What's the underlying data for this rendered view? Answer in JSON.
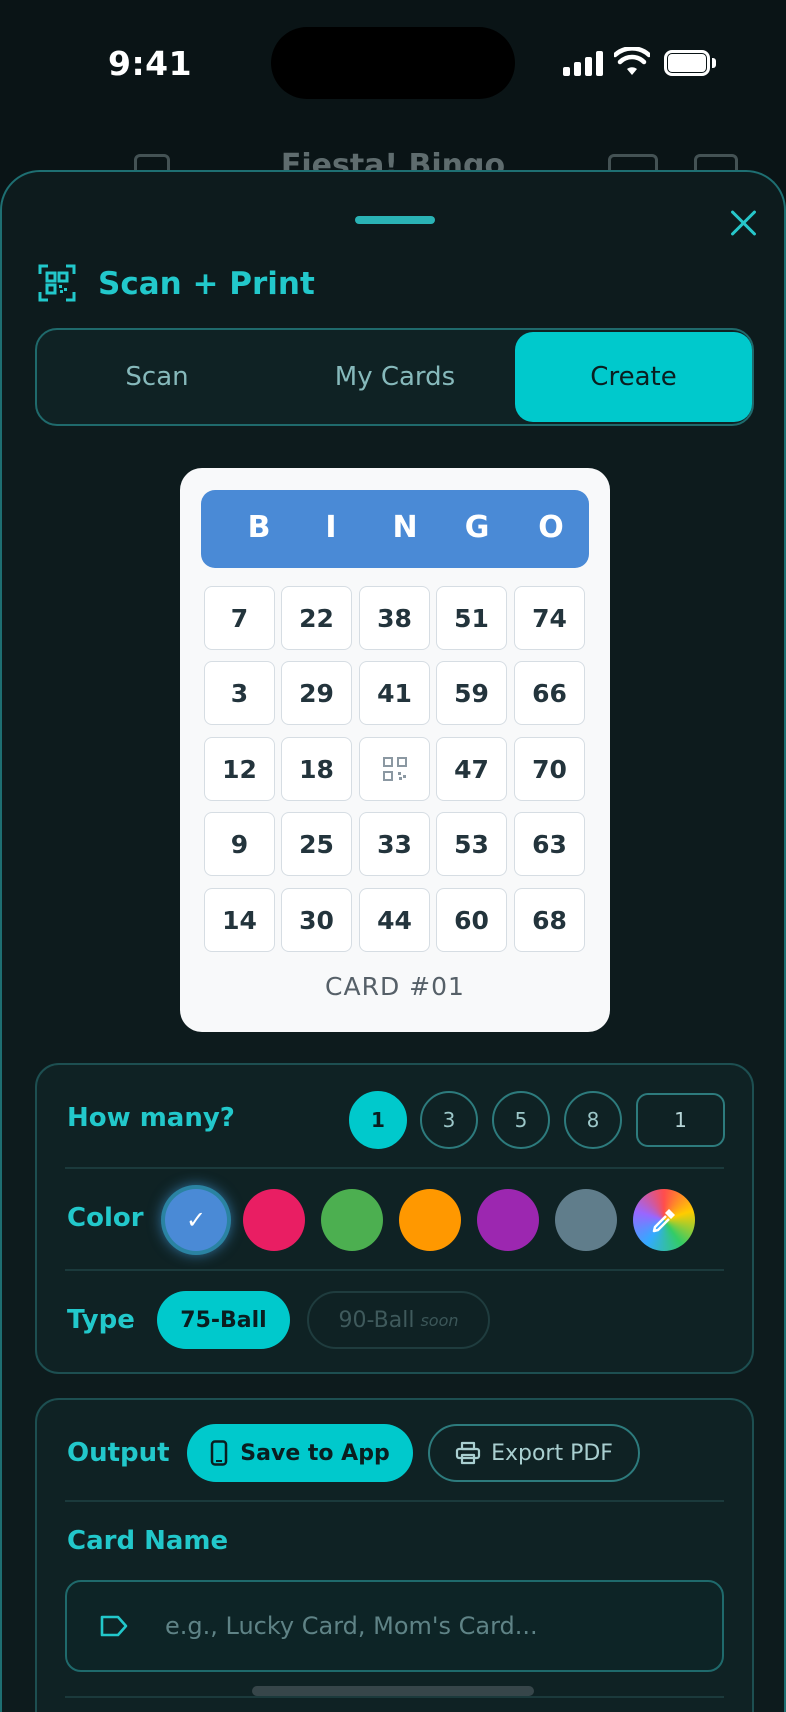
{
  "status_bar": {
    "time": "9:41"
  },
  "app": {
    "title": "Fiesta! Bingo"
  },
  "sheet": {
    "title": "Scan + Print",
    "tabs": [
      {
        "label": "Scan",
        "active": false
      },
      {
        "label": "My Cards",
        "active": false
      },
      {
        "label": "Create",
        "active": true
      }
    ]
  },
  "card": {
    "header": [
      "B",
      "I",
      "N",
      "G",
      "O"
    ],
    "rows": [
      [
        "7",
        "22",
        "38",
        "51",
        "74"
      ],
      [
        "3",
        "29",
        "41",
        "59",
        "66"
      ],
      [
        "12",
        "18",
        "",
        "47",
        "70"
      ],
      [
        "9",
        "25",
        "33",
        "53",
        "63"
      ],
      [
        "14",
        "30",
        "44",
        "60",
        "68"
      ]
    ],
    "free_space_icon": "qr-code-icon",
    "label": "CARD #01"
  },
  "options": {
    "how_many": {
      "label": "How many?",
      "choices": [
        "1",
        "3",
        "5",
        "8"
      ],
      "selected": "1",
      "custom_value": "1"
    },
    "color": {
      "label": "Color",
      "swatches": [
        "#4a8ad6",
        "#e91e63",
        "#4caf50",
        "#ff9800",
        "#9c27b0",
        "#607d8b"
      ],
      "selected_index": 0,
      "custom_picker_icon": "eyedropper-icon"
    },
    "type": {
      "label": "Type",
      "options": [
        {
          "label": "75-Ball",
          "active": true,
          "note": ""
        },
        {
          "label": "90-Ball",
          "active": false,
          "note": "soon"
        }
      ]
    }
  },
  "output": {
    "label": "Output",
    "save_label": "Save to App",
    "export_label": "Export PDF",
    "selected": "Save to App"
  },
  "card_name": {
    "label": "Card Name",
    "placeholder": "e.g., Lucky Card, Mom's Card...",
    "value": ""
  },
  "colors": {
    "accent": "#00c9cc",
    "background": "#0a1416",
    "card_header": "#4a8ad6"
  }
}
